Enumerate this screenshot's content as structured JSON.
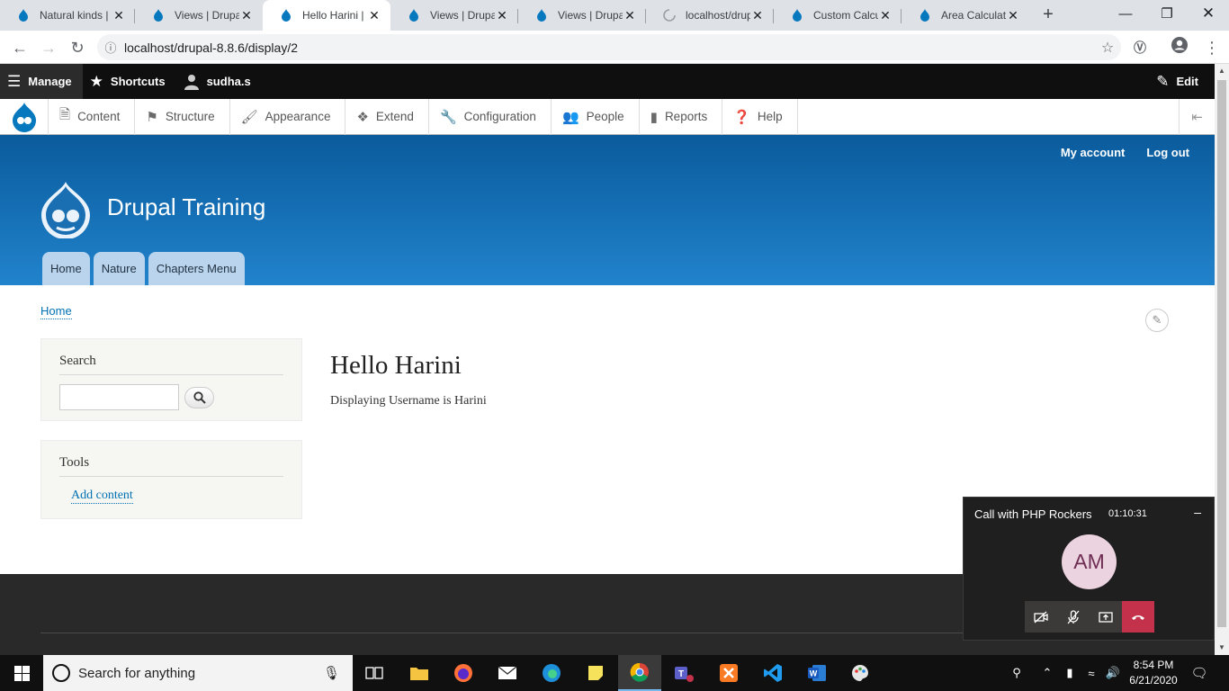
{
  "browser": {
    "tabs": [
      {
        "title": "Natural kinds |",
        "active": false
      },
      {
        "title": "Views | Drupal",
        "active": false
      },
      {
        "title": "Hello Harini | D",
        "active": true
      },
      {
        "title": "Views | Drupal",
        "active": false
      },
      {
        "title": "Views | Drupal",
        "active": false
      },
      {
        "title": "localhost/drup",
        "active": false,
        "loading": true
      },
      {
        "title": "Custom Calcul",
        "active": false
      },
      {
        "title": "Area Calculatio",
        "active": false
      }
    ],
    "url": "localhost/drupal-8.8.6/display/2"
  },
  "admin_toolbar": {
    "manage": "Manage",
    "shortcuts": "Shortcuts",
    "user": "sudha.s",
    "edit": "Edit"
  },
  "admin_tray": {
    "items": [
      "Content",
      "Structure",
      "Appearance",
      "Extend",
      "Configuration",
      "People",
      "Reports",
      "Help"
    ]
  },
  "site": {
    "name": "Drupal Training",
    "secondary_menu": [
      "My account",
      "Log out"
    ],
    "main_menu": [
      "Home",
      "Nature",
      "Chapters Menu"
    ]
  },
  "breadcrumb": "Home",
  "sidebar": {
    "search_title": "Search",
    "tools_title": "Tools",
    "tools_link": "Add content"
  },
  "content": {
    "title": "Hello Harini",
    "body": "Displaying Username is Harini"
  },
  "call": {
    "title": "Call with PHP Rockers",
    "duration": "01:10:31",
    "initials": "AM"
  },
  "taskbar": {
    "search_placeholder": "Search for anything",
    "time": "8:54 PM",
    "date": "6/21/2020"
  },
  "colors": {
    "drupal_blue": "#0a5b9c",
    "link": "#0071b3",
    "hangup": "#c4314b"
  }
}
